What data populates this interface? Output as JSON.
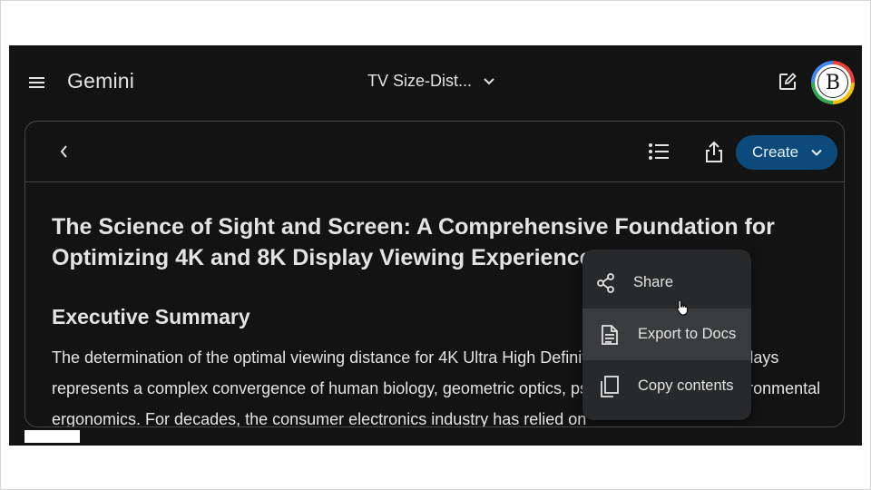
{
  "app": {
    "brand": "Gemini",
    "conversation_title": "TV Size-Dist..."
  },
  "icons": {
    "menu": "hamburger-icon",
    "title_dropdown": "chevron-down-icon",
    "edit": "edit-icon",
    "back": "chevron-left-icon",
    "outline": "list-icon",
    "share": "share-icon",
    "create_dropdown": "chevron-down-icon"
  },
  "avatar": {
    "letter": "B"
  },
  "toolbar": {
    "create_label": "Create"
  },
  "menu": {
    "items": [
      {
        "label": "Share",
        "icon": "share-nodes-icon"
      },
      {
        "label": "Export to Docs",
        "icon": "document-icon"
      },
      {
        "label": "Copy contents",
        "icon": "copy-icon"
      }
    ]
  },
  "document": {
    "title": "The Science of Sight and Screen: A Comprehensive Foundation for Optimizing 4K and 8K Display Viewing Experiences",
    "section_heading": "Executive Summary",
    "paragraph": "The determination of the optimal viewing distance for 4K Ultra High Definition (UHD) and 8K displays represents a complex convergence of human biology, geometric optics, psychophysics, and environmental ergonomics. For decades, the consumer electronics industry has relied on"
  },
  "colors": {
    "background": "#131314",
    "text": "#e3e3e3",
    "create_button": "#0b4a7a",
    "menu_bg": "#28292a",
    "menu_active": "#3a3b3c",
    "border": "#444746"
  }
}
